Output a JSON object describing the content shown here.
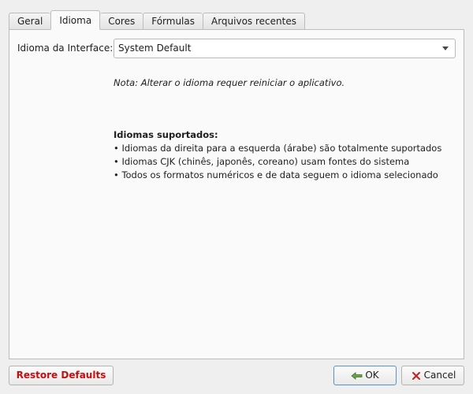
{
  "tabs": [
    {
      "label": "Geral",
      "active": false
    },
    {
      "label": "Idioma",
      "active": true
    },
    {
      "label": "Cores",
      "active": false
    },
    {
      "label": "Fórmulas",
      "active": false
    },
    {
      "label": "Arquivos recentes",
      "active": false
    }
  ],
  "language": {
    "label": "Idioma da Interface:",
    "selected": "System Default"
  },
  "note": "Nota: Alterar o idioma requer reiniciar o aplicativo.",
  "supported": {
    "title": "Idiomas suportados:",
    "items": [
      "• Idiomas da direita para a esquerda (árabe) são totalmente suportados",
      "• Idiomas CJK (chinês, japonês, coreano) usam fontes do sistema",
      "• Todos os formatos numéricos e de data seguem o idioma selecionado"
    ]
  },
  "buttons": {
    "restore": "Restore Defaults",
    "ok": "OK",
    "cancel": "Cancel"
  },
  "colors": {
    "restore_text": "#c01010",
    "ok_icon": "#6ba24a",
    "cancel_icon": "#c42020"
  },
  "icons": {
    "ok": "check-arrow-icon",
    "cancel": "x-icon"
  }
}
